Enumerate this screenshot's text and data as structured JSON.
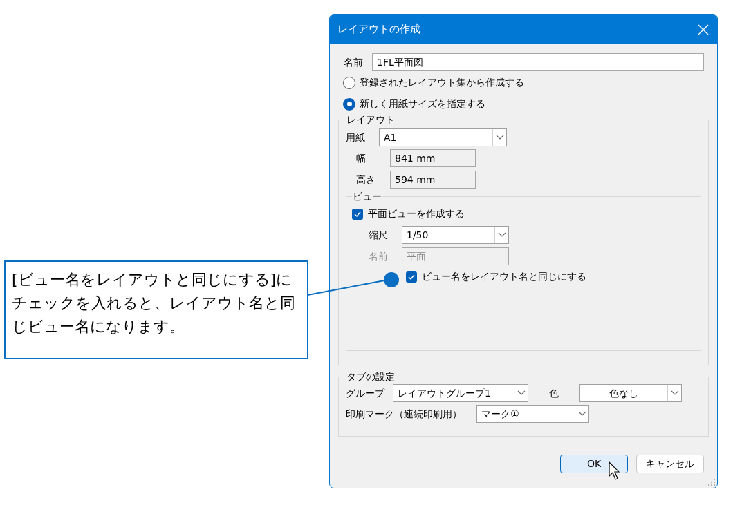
{
  "dialog": {
    "title": "レイアウトの作成",
    "name": {
      "label": "名前",
      "value": "1FL平面図"
    },
    "source_options": [
      {
        "label": "登録されたレイアウト集から作成する",
        "selected": false
      },
      {
        "label": "新しく用紙サイズを指定する",
        "selected": true
      }
    ],
    "layout_group": {
      "title": "レイアウト",
      "paper": {
        "label": "用紙",
        "value": "A1"
      },
      "width": {
        "label": "幅",
        "value": "841 mm"
      },
      "height": {
        "label": "高さ",
        "value": "594 mm"
      },
      "view_group": {
        "title": "ビュー",
        "create_plan_view": {
          "label": "平面ビューを作成する",
          "checked": true
        },
        "scale": {
          "label": "縮尺",
          "value": "1/50"
        },
        "view_name": {
          "label": "名前",
          "value": "平面",
          "disabled": true
        },
        "same_name": {
          "label": "ビュー名をレイアウト名と同じにする",
          "checked": true
        }
      }
    },
    "tab_settings": {
      "title": "タブの設定",
      "group": {
        "label": "グループ",
        "value": "レイアウトグループ1"
      },
      "color": {
        "label": "色",
        "value": "色なし"
      },
      "print_mark": {
        "label": "印刷マーク（連続印刷用）",
        "value": "マーク①"
      }
    },
    "buttons": [
      {
        "label": "OK",
        "kind": "default"
      },
      {
        "label": "キャンセル",
        "kind": "normal"
      }
    ]
  },
  "callout": {
    "text": "[ビュー名をレイアウトと同じにする]にチェックを入れると、レイアウト名と同じビュー名になります。"
  }
}
